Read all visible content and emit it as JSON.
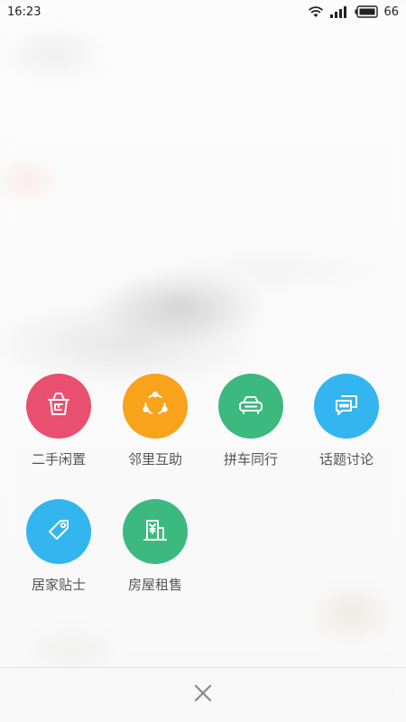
{
  "status_bar": {
    "time": "16:23",
    "battery": "66",
    "icons": [
      "wifi-icon",
      "signal-icon",
      "battery-icon"
    ]
  },
  "actions": [
    {
      "label": "二手闲置",
      "icon": "shopping-basket-icon",
      "color": "#E94F6E"
    },
    {
      "label": "邻里互助",
      "icon": "share-circle-icon",
      "color": "#F9A21B"
    },
    {
      "label": "拼车同行",
      "icon": "car-icon",
      "color": "#3BB97F"
    },
    {
      "label": "话题讨论",
      "icon": "chat-bubbles-icon",
      "color": "#33B5EF"
    },
    {
      "label": "居家贴士",
      "icon": "tag-icon",
      "color": "#33B5EF"
    },
    {
      "label": "房屋租售",
      "icon": "building-yuan-icon",
      "color": "#3BB97F"
    }
  ],
  "bottom_bar": {
    "close_icon": "close-icon"
  }
}
